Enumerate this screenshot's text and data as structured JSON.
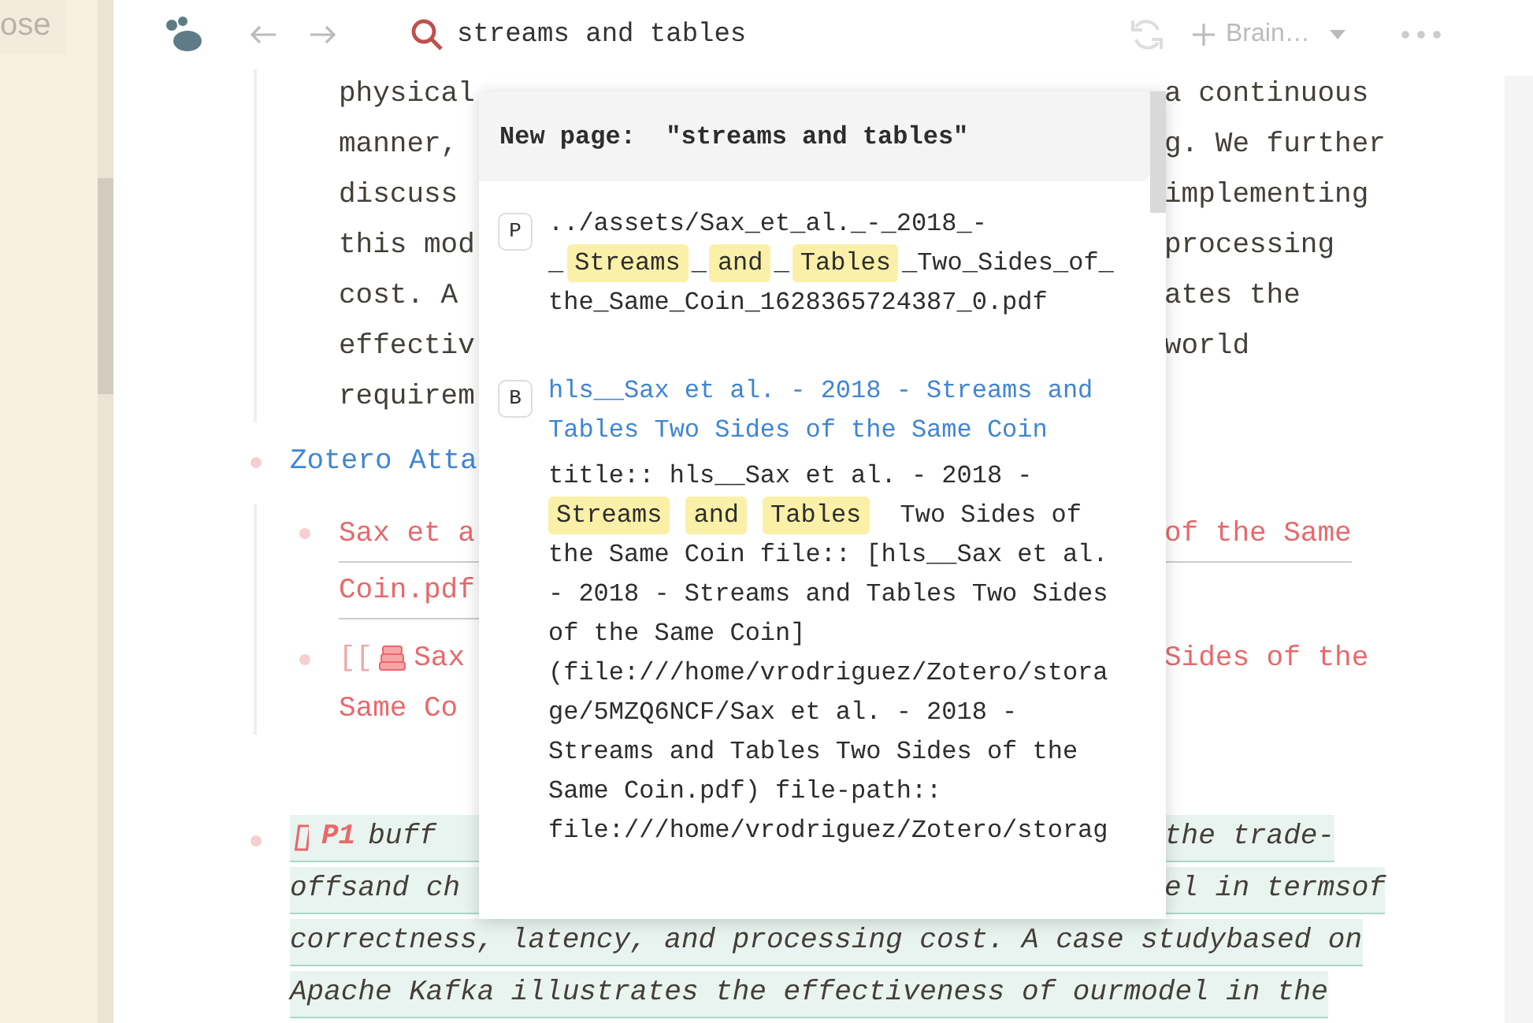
{
  "sidebar": {
    "item_label": "ose"
  },
  "toolbar": {
    "search": {
      "value": "streams and tables"
    },
    "graph_button": {
      "label": "Brain…"
    }
  },
  "document": {
    "paragraph_lines": [
      {
        "left": "physical",
        "right": "a continuous"
      },
      {
        "left": "manner,",
        "right": "g. We further"
      },
      {
        "left": "discuss",
        "right": "implementing"
      },
      {
        "left": "this mod",
        "right": "processing"
      },
      {
        "left": "cost. A",
        "right": "ates the"
      },
      {
        "left": "effectiv",
        "right": "world"
      },
      {
        "left": "requirem"
      }
    ],
    "outline": [
      {
        "kind": "link",
        "text": "Zotero Atta",
        "children": [
          {
            "kind": "file_link",
            "lines": [
              {
                "left": "Sax et a",
                "right": "of the Same"
              },
              {
                "left": "Coin.pdf"
              }
            ]
          },
          {
            "kind": "page_ref",
            "prefix": "[[",
            "lines": [
              {
                "left": "Sax",
                "right": "Sides of the"
              },
              {
                "left": "Same Co"
              }
            ]
          }
        ]
      },
      {
        "kind": "highlight",
        "tag": "P1",
        "lines": [
          {
            "left": "buff",
            "right": "the trade-"
          },
          {
            "left": "offsand ch",
            "right": "el in termsof"
          },
          {
            "full": "correctness, latency, and processing cost. A case studybased on"
          },
          {
            "full": "Apache Kafka illustrates the effectiveness of ourmodel in the"
          }
        ]
      }
    ]
  },
  "search_popup": {
    "new_page": "New page:  \"streams and tables\"",
    "results": [
      {
        "kind": "page",
        "badge": "P",
        "segments": [
          {
            "text": "../assets/Sax_et_al._-_2018_-_"
          },
          {
            "text": "Streams",
            "highlight": true
          },
          {
            "text": "_"
          },
          {
            "text": "and",
            "highlight": true
          },
          {
            "text": "_"
          },
          {
            "text": "Tables",
            "highlight": true
          },
          {
            "text": "_Two_Sides_of_the_Same_Coin_1628365724387_0.pdf"
          }
        ]
      },
      {
        "kind": "block",
        "badge": "B",
        "title": "hls__Sax et al. - 2018 - Streams and Tables Two Sides of the Same Coin",
        "segments": [
          {
            "text": "title:: hls__Sax et al. - 2018 - "
          },
          {
            "text": "Streams",
            "highlight": true
          },
          {
            "text": "and",
            "highlight": true
          },
          {
            "text": "Tables",
            "highlight": true
          },
          {
            "text": " Two Sides of the Same Coin file:: [hls__Sax et al. - 2018 - Streams and Tables Two Sides of the Same Coin](file:///home/vrodriguez/Zotero/storage/5MZQ6NCF/Sax et al. - 2018 - Streams and Tables Two Sides of the Same Coin.pdf) file-path:: file:///home/vrodriguez/Zotero/storag"
          }
        ]
      }
    ]
  }
}
